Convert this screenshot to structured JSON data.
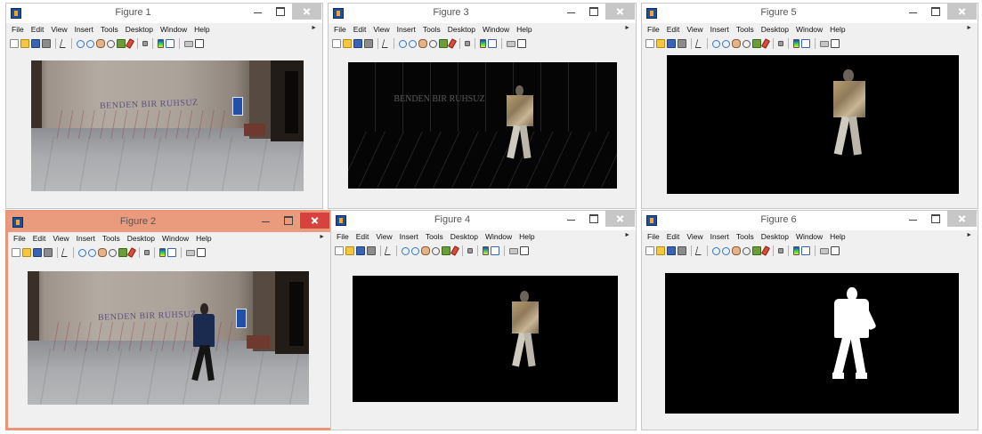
{
  "menu_items": [
    "File",
    "Edit",
    "View",
    "Insert",
    "Tools",
    "Desktop",
    "Window",
    "Help"
  ],
  "toolbar_icons": [
    "new-figure-icon",
    "open-file-icon",
    "save-icon",
    "print-icon",
    "edit-plot-icon",
    "zoom-in-icon",
    "zoom-out-icon",
    "pan-icon",
    "rotate-3d-icon",
    "data-cursor-icon",
    "brush-icon",
    "link-plot-icon",
    "insert-colorbar-icon",
    "insert-legend-icon",
    "hide-plot-tools-icon",
    "show-plot-tools-icon"
  ],
  "colors": {
    "active_title_bar": "#eb9b7d",
    "active_close": "#d7423e",
    "window_bg": "#f0f0f0"
  },
  "figures": [
    {
      "title": "Figure 1",
      "image": "original-frame-empty-corridor",
      "active": false
    },
    {
      "title": "Figure 3",
      "image": "frame-difference-dark",
      "active": false
    },
    {
      "title": "Figure 5",
      "image": "segmented-person-color-on-black",
      "active": false
    },
    {
      "title": "Figure 2",
      "image": "original-frame-with-person",
      "active": true
    },
    {
      "title": "Figure 4",
      "image": "segmented-person-color-on-black",
      "active": false
    },
    {
      "title": "Figure 6",
      "image": "binary-mask-white-silhouette",
      "active": false
    }
  ],
  "graffiti_text": "BENDEN BIR RUHSUZ"
}
